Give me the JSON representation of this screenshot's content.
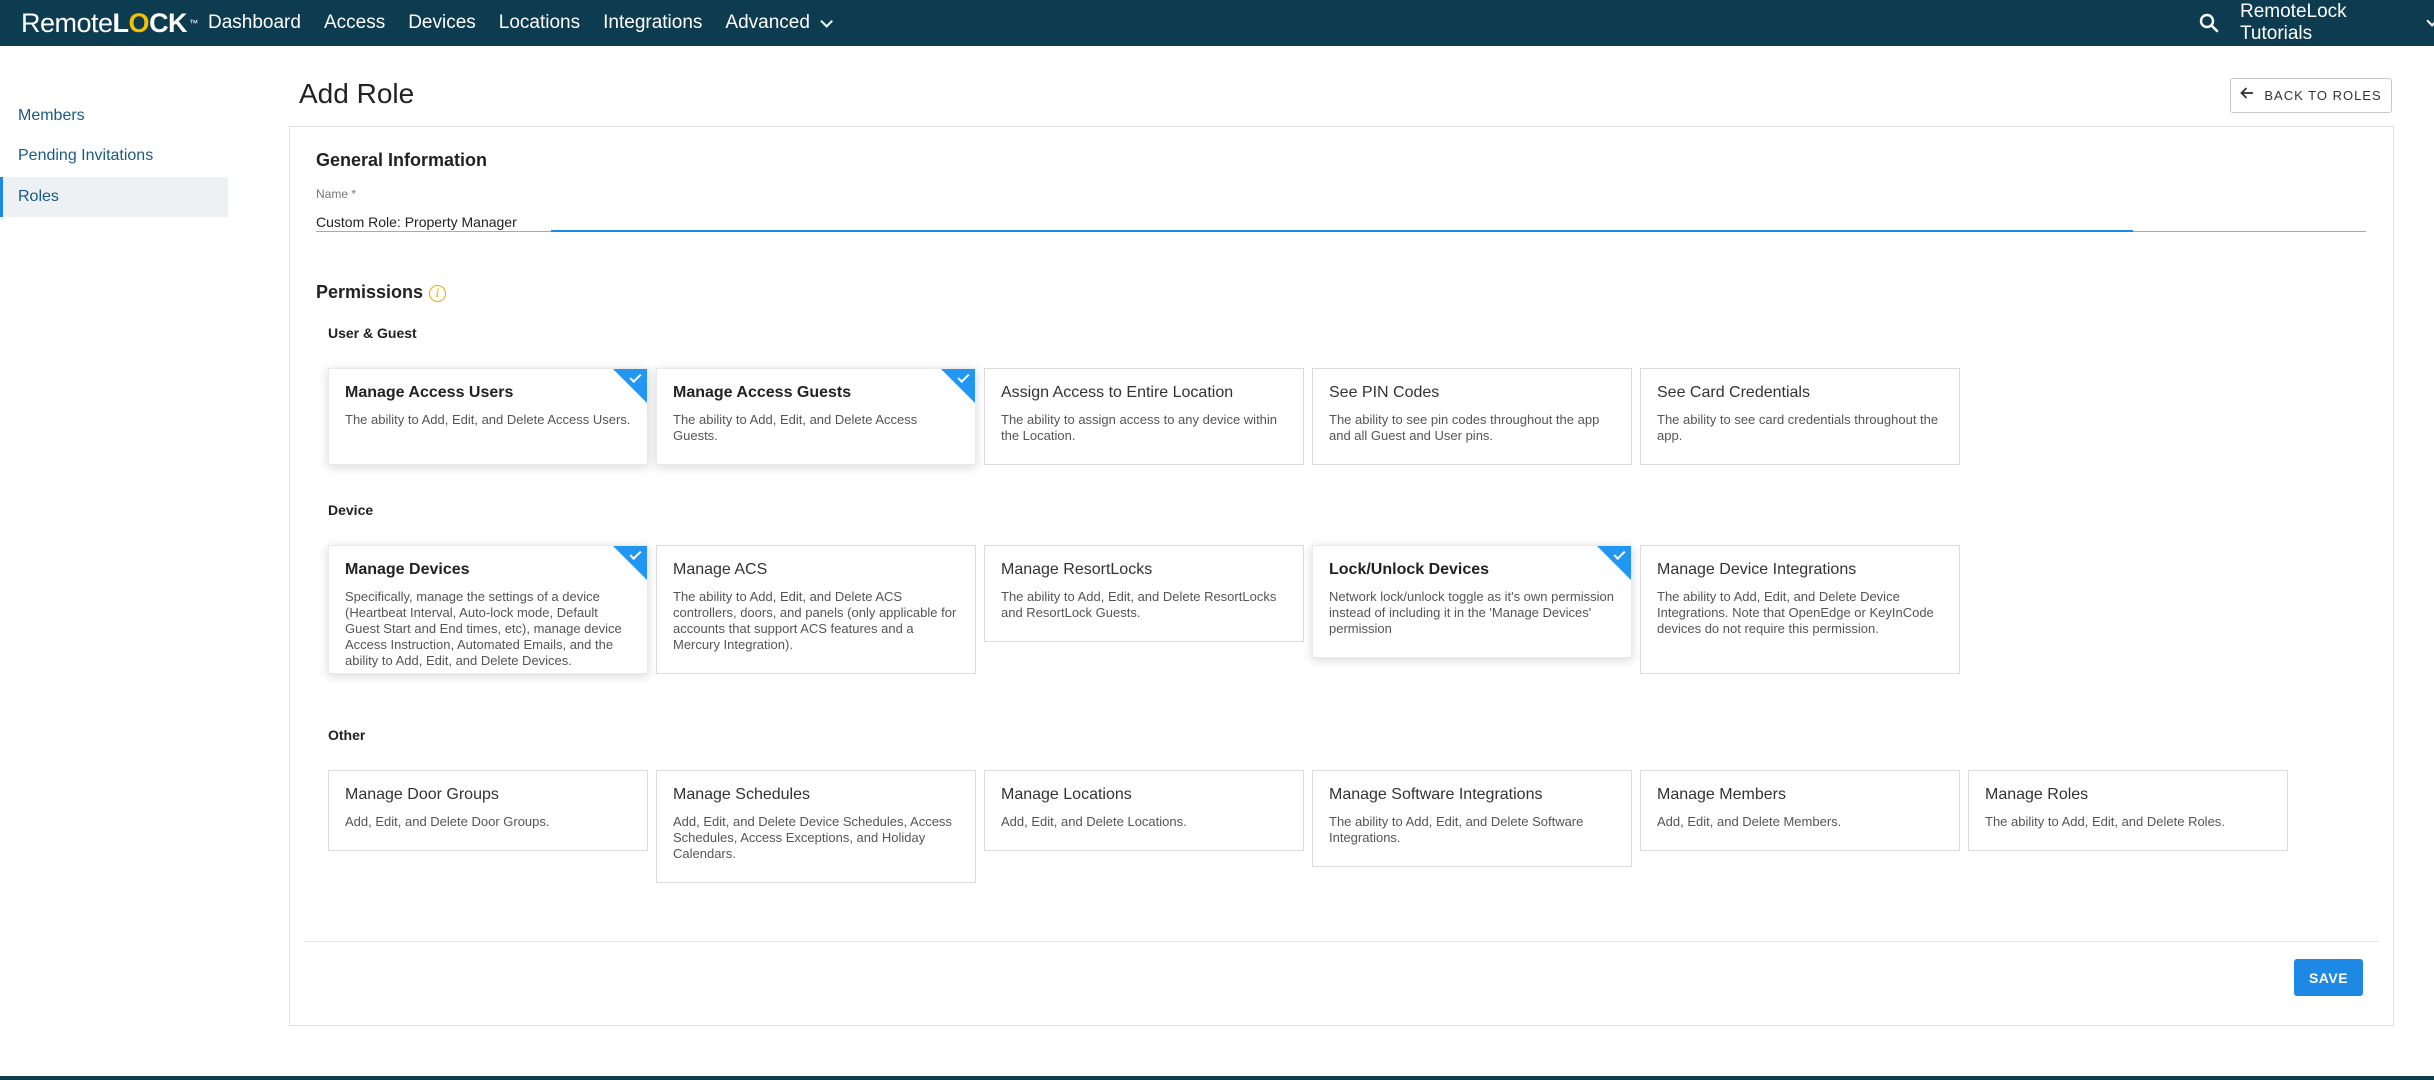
{
  "brand": {
    "logo_part1": "Remote",
    "logo_part2_pre": "L",
    "logo_part2_o": "O",
    "logo_part2_post": "CK",
    "logo_tm": "™"
  },
  "nav": {
    "items": [
      "Dashboard",
      "Access",
      "Devices",
      "Locations",
      "Integrations"
    ],
    "advanced_label": "Advanced",
    "account_label": "RemoteLock Tutorials"
  },
  "sidebar": {
    "items": [
      "Members",
      "Pending Invitations",
      "Roles"
    ],
    "active": "Roles"
  },
  "header": {
    "title": "Add Role",
    "back_label": "BACK TO ROLES"
  },
  "general": {
    "title": "General Information",
    "name_label": "Name *",
    "name_value": "Custom Role: Property Manager"
  },
  "permissions": {
    "title": "Permissions",
    "info_glyph": "i",
    "groups": [
      {
        "label": "User & Guest",
        "cards": [
          {
            "title": "Manage Access Users",
            "desc": "The ability to Add, Edit, and Delete Access Users.",
            "selected": true
          },
          {
            "title": "Manage Access Guests",
            "desc": "The ability to Add, Edit, and Delete Access Guests.",
            "selected": true
          },
          {
            "title": "Assign Access to Entire Location",
            "desc": "The ability to assign access to any device within the Location.",
            "selected": false
          },
          {
            "title": "See PIN Codes",
            "desc": "The ability to see pin codes throughout the app and all Guest and User pins.",
            "selected": false
          },
          {
            "title": "See Card Credentials",
            "desc": "The ability to see card credentials throughout the app.",
            "selected": false
          }
        ]
      },
      {
        "label": "Device",
        "cards": [
          {
            "title": "Manage Devices",
            "desc": "Specifically, manage the settings of a device (Heartbeat Interval, Auto-lock mode, Default Guest Start and End times, etc), manage device Access Instruction, Automated Emails, and the ability to Add, Edit, and Delete Devices.",
            "selected": true
          },
          {
            "title": "Manage ACS",
            "desc": "The ability to Add, Edit, and Delete ACS controllers, doors, and panels (only applicable for accounts that support ACS features and a Mercury Integration).",
            "selected": false
          },
          {
            "title": "Manage ResortLocks",
            "desc": "The ability to Add, Edit, and Delete ResortLocks and ResortLock Guests.",
            "selected": false
          },
          {
            "title": "Lock/Unlock Devices",
            "desc": "Network lock/unlock toggle as it's own permission instead of including it in the 'Manage Devices' permission",
            "selected": true
          },
          {
            "title": "Manage Device Integrations",
            "desc": "The ability to Add, Edit, and Delete Device Integrations. Note that OpenEdge or KeyInCode devices do not require this permission.",
            "selected": false
          }
        ]
      },
      {
        "label": "Other",
        "cards": [
          {
            "title": "Manage Door Groups",
            "desc": "Add, Edit, and Delete Door Groups.",
            "selected": false
          },
          {
            "title": "Manage Schedules",
            "desc": "Add, Edit, and Delete Device Schedules, Access Schedules, Access Exceptions, and Holiday Calendars.",
            "selected": false
          },
          {
            "title": "Manage Locations",
            "desc": "Add, Edit, and Delete Locations.",
            "selected": false
          },
          {
            "title": "Manage Software Integrations",
            "desc": "The ability to Add, Edit, and Delete Software Integrations.",
            "selected": false
          },
          {
            "title": "Manage Members",
            "desc": "Add, Edit, and Delete Members.",
            "selected": false
          },
          {
            "title": "Manage Roles",
            "desc": "The ability to Add, Edit, and Delete Roles.",
            "selected": false
          }
        ]
      }
    ]
  },
  "footer": {
    "save_label": "SAVE"
  },
  "colors": {
    "nav_bg": "#0d3b4f",
    "accent": "#1e88e5",
    "logo_o": "#f2c200",
    "info": "#f2a900"
  },
  "icons": {
    "search": "search-icon",
    "back": "arrow-left-icon",
    "info": "info-icon",
    "check": "check-icon",
    "chevron": "chevron-down-icon"
  }
}
